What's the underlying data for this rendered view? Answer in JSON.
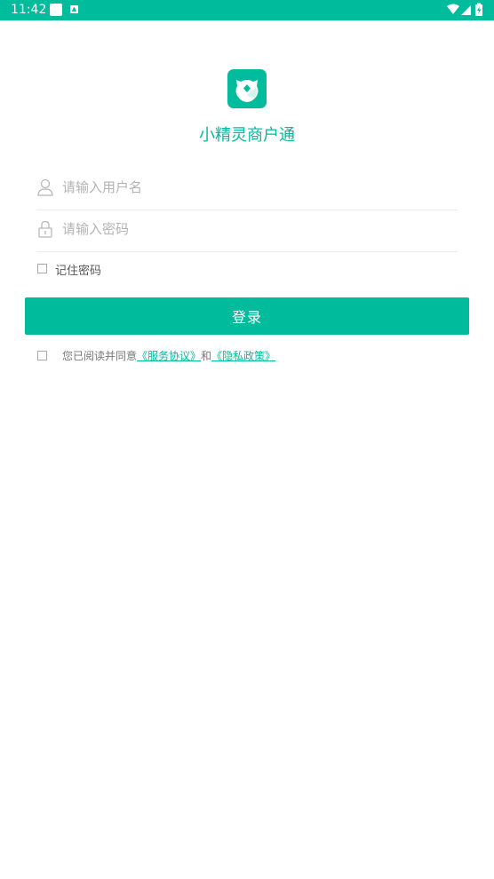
{
  "status_bar": {
    "time": "11:42",
    "icons": [
      "notification-square-icon",
      "a-notification-icon",
      "wifi-icon",
      "cell-signal-icon",
      "battery-charging-icon"
    ],
    "color": "#00bb9c"
  },
  "app": {
    "logo_icon": "app-logo-icon",
    "title": "小精灵商户通",
    "accent": "#00bb9c"
  },
  "form": {
    "username_placeholder": "请输入用户名",
    "username_value": "",
    "username_icon": "user-icon",
    "password_placeholder": "请输入密码",
    "password_value": "",
    "password_icon": "lock-icon",
    "remember_label": "记住密码",
    "remember_checked": false,
    "login_label": "登录"
  },
  "agreement": {
    "checked": false,
    "prefix": "您已阅读并同意",
    "service_link": "《服务协议》",
    "and": "和",
    "privacy_link": "《隐私政策》"
  }
}
